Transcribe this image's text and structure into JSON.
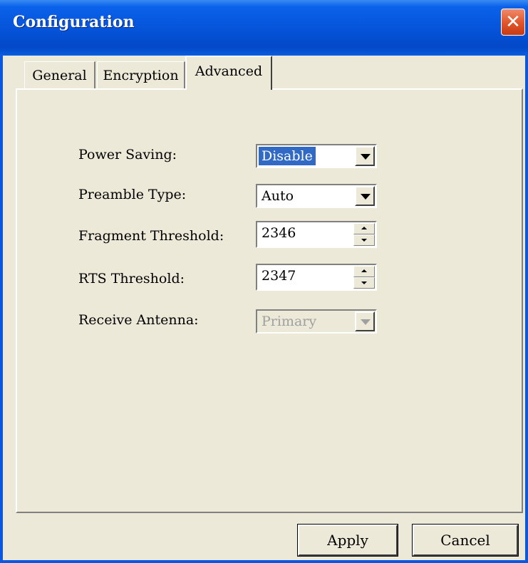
{
  "window": {
    "title": "Configuration",
    "close_symbol": "✕"
  },
  "tabs": [
    {
      "label": "General",
      "active": false
    },
    {
      "label": "Encryption",
      "active": false
    },
    {
      "label": "Advanced",
      "active": true
    }
  ],
  "fields": {
    "power_saving": {
      "label": "Power Saving:",
      "value": "Disable"
    },
    "preamble_type": {
      "label": "Preamble Type:",
      "value": "Auto"
    },
    "fragment_threshold": {
      "label": "Fragment Threshold:",
      "value": "2346"
    },
    "rts_threshold": {
      "label": "RTS Threshold:",
      "value": "2347"
    },
    "receive_antenna": {
      "label": "Receive Antenna:",
      "value": "Primary",
      "disabled": true
    }
  },
  "buttons": {
    "apply": "Apply",
    "cancel": "Cancel"
  }
}
